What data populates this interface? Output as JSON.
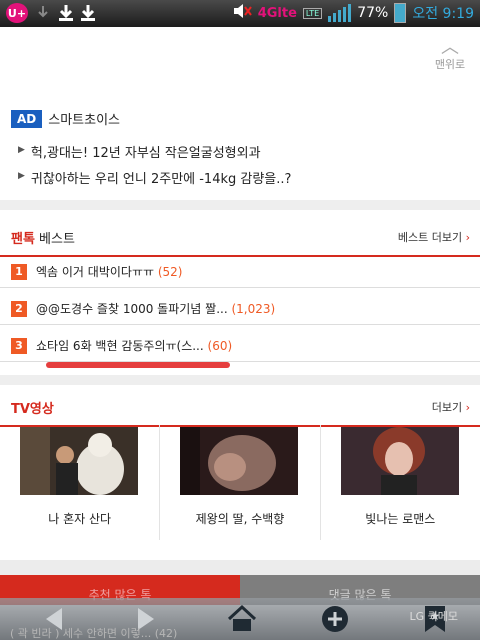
{
  "status_bar": {
    "carrier_icon": "U+",
    "network": "4Glte",
    "lte_badge": "LTE",
    "battery": "77%",
    "time": "오전 9:19"
  },
  "to_top": {
    "label": "맨위로"
  },
  "ad": {
    "badge": "AD",
    "brand": "스마트초이스",
    "items": [
      "헉,광대는! 12년 자부심 작은얼굴성형외과",
      "귀찮아하는 우리 언니 2주만에 -14kg 감량을..?"
    ]
  },
  "fantalk": {
    "title_red": "팬톡",
    "title_rest": " 베스트",
    "more": "베스트 더보기",
    "rows": [
      {
        "rank": "1",
        "text": "엑솜 이거 대박이다ㅠㅠ",
        "count": "(52)"
      },
      {
        "rank": "2",
        "text": "@@도경수 즐찾 1000 돌파기념 짤...",
        "count": "(1,023)"
      },
      {
        "rank": "3",
        "text": "쇼타임 6화 백현 감동주의ㅠ(스...",
        "count": "(60)"
      }
    ]
  },
  "tv": {
    "title": "TV영상",
    "more": "더보기",
    "videos": [
      {
        "title": "나 혼자 산다"
      },
      {
        "title": "제왕의 딸, 수백향"
      },
      {
        "title": "빛나는 로맨스"
      }
    ]
  },
  "bottom": {
    "tabs": [
      "추천 많은 톡",
      "댓글 많은 톡"
    ],
    "peek_text": "( 곽 빈라 ) 세수 안하면 이렇... (42)",
    "lg_memo": "LG 퀵메모"
  },
  "colors": {
    "accent_red": "#d52a1e",
    "rank_orange": "#ef5a25",
    "ad_blue": "#1a5fbf"
  }
}
